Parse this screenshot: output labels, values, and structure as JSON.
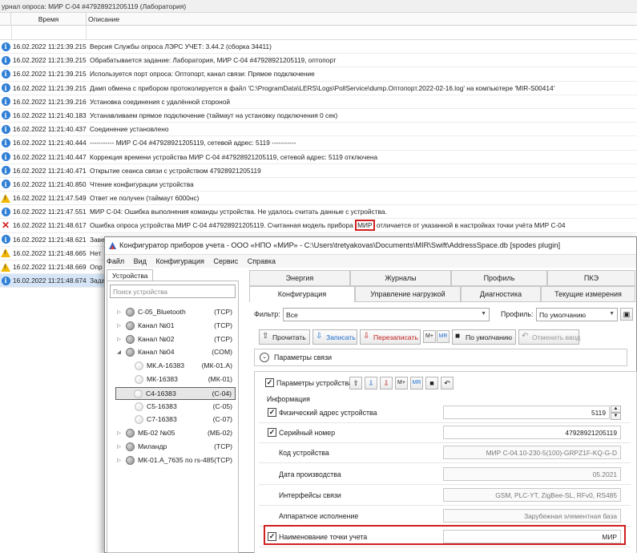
{
  "journal": {
    "title": "урнал опроса: МИР С-04 #47928921205119 (Лаборатория)",
    "col_time": "Время",
    "col_desc": "Описание",
    "rows": [
      {
        "icon": "info",
        "time": "16.02.2022 11:21:39.215",
        "msg": "Версия Службы опроса ЛЭРС УЧЕТ: 3.44.2 (сборка 34411)"
      },
      {
        "icon": "info",
        "time": "16.02.2022 11:21:39.215",
        "msg": "Обрабатывается задание: Лаборатория, МИР С-04 #47928921205119, оптопорт"
      },
      {
        "icon": "info",
        "time": "16.02.2022 11:21:39.215",
        "msg": "Используется порт опроса: Оптопорт, канал связи: Прямое подключение"
      },
      {
        "icon": "info",
        "time": "16.02.2022 11:21:39.215",
        "msg": "Дамп обмена с прибором протоколируется в файл 'C:\\ProgramData\\LERS\\Logs\\PollService\\dump.Оптопорт.2022-02-16.log' на компьютере 'MIR-S00414'"
      },
      {
        "icon": "info",
        "time": "16.02.2022 11:21:39.216",
        "msg": "Установка соединения с удалённой стороной"
      },
      {
        "icon": "info",
        "time": "16.02.2022 11:21:40.183",
        "msg": "Устанавливаем прямое подключение (таймаут на установку подключения 0 сек)"
      },
      {
        "icon": "info",
        "time": "16.02.2022 11:21:40.437",
        "msg": "Соединение установлено"
      },
      {
        "icon": "info",
        "time": "16.02.2022 11:21:40.444",
        "msg": "----------- МИР С-04 #47928921205119, сетевой адрес: 5119 -----------"
      },
      {
        "icon": "info",
        "time": "16.02.2022 11:21:40.447",
        "msg": "Коррекция времени устройства МИР С-04 #47928921205119, сетевой адрес: 5119 отключена"
      },
      {
        "icon": "info",
        "time": "16.02.2022 11:21:40.471",
        "msg": "Открытие сеанса связи с устройством 47928921205119"
      },
      {
        "icon": "info",
        "time": "16.02.2022 11:21:40.850",
        "msg": "Чтение конфигурации устройства"
      },
      {
        "icon": "warn",
        "time": "16.02.2022 11:21:47.549",
        "msg": "Ответ не получен (таймаут 6000нс)"
      },
      {
        "icon": "info",
        "time": "16.02.2022 11:21:47.551",
        "msg": "МИР С-04: Ошибка выполнения команды устройства. Не удалось считать данные с устройства."
      },
      {
        "icon": "error",
        "time": "16.02.2022 11:21:48.617",
        "msg": "Ошибка опроса устройства МИР С-04 #47928921205119. Считанная модель прибора",
        "msg_hl": "МИР",
        "msg_tail": "отличается от указанной в настройках точки учёта МИР С-04"
      },
      {
        "icon": "info",
        "time": "16.02.2022 11:21:48.621",
        "msg": "Заве"
      },
      {
        "icon": "warn",
        "time": "16.02.2022 11:21:48.665",
        "msg": "Нет"
      },
      {
        "icon": "warn",
        "time": "16.02.2022 11:21:48.669",
        "msg": "Опр"
      },
      {
        "icon": "info",
        "time": "16.02.2022 11:21:48.674",
        "msg": "Зада"
      }
    ]
  },
  "configurator": {
    "title": "Конфигуратор приборов учета - ООО «НПО «МИР» - C:\\Users\\tretyakovas\\Documents\\MIR\\Swift\\AddressSpace.db [spodes plugin]",
    "menu": [
      "Файл",
      "Вид",
      "Конфигурация",
      "Сервис",
      "Справка"
    ],
    "devices_tab": "Устройства",
    "search_placeholder": "Поиск устройства",
    "tree": [
      {
        "name": "С-05_Bluetooth",
        "type": "(TCP)"
      },
      {
        "name": "Канал №01",
        "type": "(TCP)"
      },
      {
        "name": "Канал №02",
        "type": "(TCP)"
      },
      {
        "name": "Канал №04",
        "type": "(COM)"
      },
      {
        "name": "МК.А-16383",
        "type": "(МК-01.А)"
      },
      {
        "name": "МК-16383",
        "type": "(МК-01)"
      },
      {
        "name": "С4-16383",
        "type": "(С-04)"
      },
      {
        "name": "С5-16383",
        "type": "(С-05)"
      },
      {
        "name": "С7-16383",
        "type": "(С-07)"
      },
      {
        "name": "МБ-02 №05",
        "type": "(МБ-02)"
      },
      {
        "name": "Миландр",
        "type": "(TCP)"
      },
      {
        "name": "МК-01.А_7635 по rs-485",
        "type": "(TCP)"
      }
    ],
    "tabs_top": [
      "Энергия",
      "Журналы",
      "Профиль",
      "ПКЭ"
    ],
    "tabs_bottom": [
      "Конфигурация",
      "Управление нагрузкой",
      "Диагностика",
      "Текущие измерения"
    ],
    "filter_label": "Фильтр:",
    "filter_value": "Все",
    "profile_label": "Профиль:",
    "profile_value": "По умолчанию",
    "toolbar": {
      "read": "Прочитать",
      "write": "Записать",
      "rewrite": "Перезаписать",
      "mplus": "M+",
      "mr": "MR",
      "default": "По умолчанию",
      "cancel": "Отменить ввод"
    },
    "conn_params": "Параметры связи",
    "device_params": "Параметры устройства",
    "info_group": "Информация",
    "params": [
      {
        "label": "Физический адрес устройства",
        "value": "5119",
        "checkbox": true
      },
      {
        "label": "Серийный номер",
        "value": "47928921205119",
        "checkbox": true
      },
      {
        "label": "Код устройства",
        "value": "МИР С-04.10-230-5(100)-GRPZ1F-KQ-G-D",
        "checkbox": false
      },
      {
        "label": "Дата производства",
        "value": "05.2021",
        "checkbox": false
      },
      {
        "label": "Интерфейсы связи",
        "value": "GSM, PLC-YT, ZigBee-SL, RFv0, RS485",
        "checkbox": false
      },
      {
        "label": "Аппаратное исполнение",
        "value": "Зарубежная элементная база",
        "checkbox": false
      },
      {
        "label": "Наименование точки учета",
        "value": "МИР",
        "checkbox": true
      }
    ],
    "colors": {
      "highlight": "#cf1f1f",
      "selection": "#d5e5f7",
      "info": "#2f7fd6",
      "warn": "#f2b705"
    }
  }
}
